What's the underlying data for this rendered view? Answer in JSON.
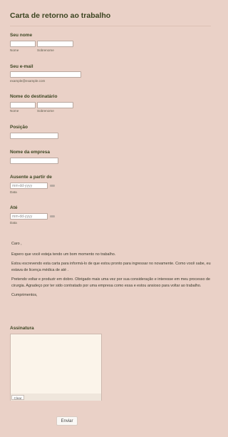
{
  "form": {
    "title": "Carta de retorno ao trabalho",
    "name": {
      "label": "Seu nome",
      "first_sublabel": "Nome",
      "last_sublabel": "Sobrenome",
      "first_value": "",
      "last_value": ""
    },
    "email": {
      "label": "Seu e-mail",
      "sublabel": "example@example.com",
      "value": ""
    },
    "recipient": {
      "label": "Nome do destinatário",
      "first_sublabel": "Nome",
      "last_sublabel": "Sobrenome"
    },
    "position": {
      "label": "Posição",
      "value": ""
    },
    "company": {
      "label": "Nome da empresa",
      "value": ""
    },
    "absent_from": {
      "label": "Ausente a partir de",
      "placeholder": "mm-dd-yyyy",
      "sublabel": "Data"
    },
    "until": {
      "label": "Até",
      "placeholder": "mm-dd-yyyy",
      "sublabel": "Data"
    },
    "letter": {
      "greeting": "Caro ,",
      "p1": "Espero que você esteja tendo um bom momento no trabalho.",
      "p2": "Estou escrevendo esta carta para informá-lo de que estou pronto para ingressar no novamente. Como você sabe, eu estava de licença médica de até .",
      "p3": "Pretendo voltar e produzir em dobro. Obrigado mais uma vez por sua consideração e interesse em meu processo de cirurgia. Agradeço por ter sido contratado por uma empresa como essa e estou ansioso para voltar ao trabalho.",
      "closing": "Cumprimentos,"
    },
    "signature": {
      "label": "Assinatura",
      "clear_label": "Clear"
    },
    "submit_label": "Enviar"
  },
  "colors": {
    "background": "#ead1c7",
    "label": "#3b4420",
    "signature_pad": "#fbf4ea"
  }
}
